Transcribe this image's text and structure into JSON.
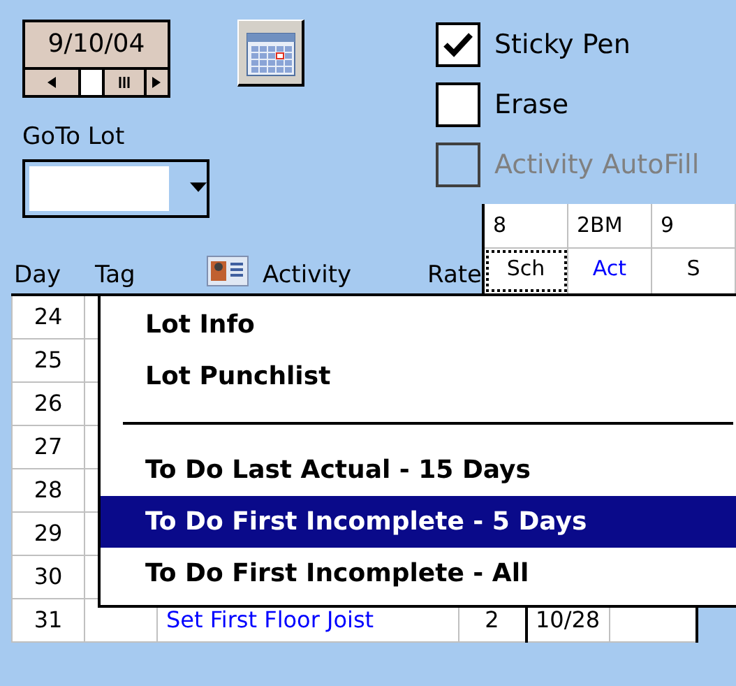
{
  "date_picker": {
    "value": "9/10/04"
  },
  "goto_lot": {
    "label": "GoTo Lot"
  },
  "checkboxes": [
    {
      "label": "Sticky Pen",
      "checked": true,
      "disabled": false
    },
    {
      "label": "Erase",
      "checked": false,
      "disabled": false
    },
    {
      "label": "Activity AutoFill",
      "checked": false,
      "disabled": true
    }
  ],
  "header": {
    "day": "Day",
    "tag": "Tag",
    "activity": "Activity",
    "rate": "Rate"
  },
  "lot_table": {
    "lots": [
      "8",
      "2BM",
      "9"
    ],
    "subheads": [
      {
        "label": "Sch",
        "kind": "schedule",
        "selected": true
      },
      {
        "label": "Act",
        "kind": "actual",
        "selected": false
      },
      {
        "label": "S",
        "kind": "schedule",
        "selected": false
      }
    ]
  },
  "rows": [
    {
      "day": "24"
    },
    {
      "day": "25"
    },
    {
      "day": "26"
    },
    {
      "day": "27"
    },
    {
      "day": "28"
    },
    {
      "day": "29"
    },
    {
      "day": "30"
    },
    {
      "day": "31",
      "activity": "Set First Floor Joist",
      "rate": "2",
      "sch": "10/28"
    }
  ],
  "context_menu": [
    {
      "kind": "item",
      "label": "Lot Info",
      "selected": false
    },
    {
      "kind": "item",
      "label": "Lot Punchlist",
      "selected": false
    },
    {
      "kind": "separator"
    },
    {
      "kind": "item",
      "label": "To Do Last Actual - 15 Days",
      "selected": false
    },
    {
      "kind": "item",
      "label": "To Do First Incomplete - 5 Days",
      "selected": true
    },
    {
      "kind": "item",
      "label": "To Do First Incomplete - All",
      "selected": false
    }
  ]
}
